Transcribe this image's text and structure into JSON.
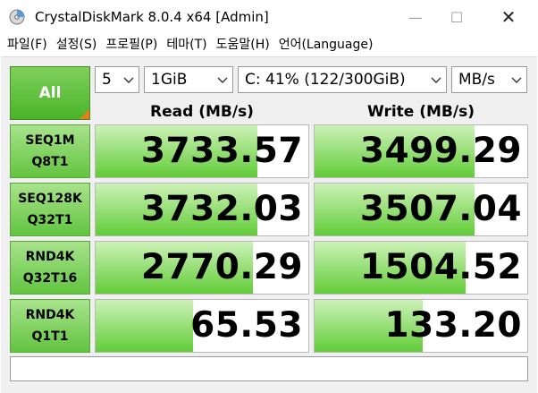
{
  "window": {
    "title": "CrystalDiskMark 8.0.4 x64 [Admin]",
    "minimize_glyph": "—",
    "maximize_glyph": "☐",
    "close_glyph": "✕",
    "icon": "crystaldiskmark-app-icon"
  },
  "menu": [
    "파일(F)",
    "설정(S)",
    "프로필(P)",
    "테마(T)",
    "도움말(H)",
    "언어(Language)"
  ],
  "controls": {
    "all_label": "All",
    "count": "5",
    "size": "1GiB",
    "drive": "C: 41% (122/300GiB)",
    "unit": "MB/s"
  },
  "headers": {
    "read": "Read (MB/s)",
    "write": "Write (MB/s)"
  },
  "tests": [
    {
      "line1": "SEQ1M",
      "line2": "Q8T1",
      "read": "3733.57",
      "write": "3499.29",
      "read_fill": 0.76,
      "write_fill": 0.75
    },
    {
      "line1": "SEQ128K",
      "line2": "Q32T1",
      "read": "3732.03",
      "write": "3507.04",
      "read_fill": 0.76,
      "write_fill": 0.75
    },
    {
      "line1": "RND4K",
      "line2": "Q32T16",
      "read": "2770.29",
      "write": "1504.52",
      "read_fill": 0.74,
      "write_fill": 0.71
    },
    {
      "line1": "RND4K",
      "line2": "Q1T1",
      "read": "65.53",
      "write": "133.20",
      "read_fill": 0.46,
      "write_fill": 0.51
    }
  ],
  "colors": {
    "accent_green": "#4ab42a",
    "bar_green": "#62cc38",
    "corner_orange": "#f07a18"
  },
  "comment": ""
}
